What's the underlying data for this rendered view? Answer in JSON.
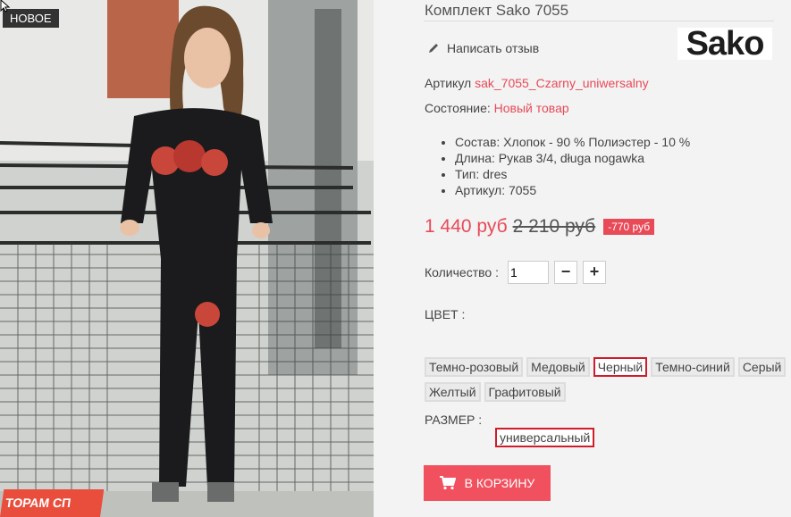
{
  "photo": {
    "badge": "НОВОЕ",
    "promo": "ТОРАМ СП"
  },
  "product": {
    "title": "Комплект Sako 7055",
    "review_label": "Написать отзыв",
    "brand_logo": "Sako",
    "sku_label": "Артикул",
    "sku_value": "sak_7055_Czarny_uniwersalny",
    "condition_label": "Состояние:",
    "condition_value": "Новый товар",
    "specs": [
      "Состав: Хлопок - 90 % Полиэстер - 10 %",
      "Длина: Рукав 3/4, długa nogawka",
      "Тип: dres",
      "Артикул: 7055"
    ],
    "price_new": "1 440 руб",
    "price_old": "2 210 руб",
    "price_save": "-770 руб"
  },
  "quantity": {
    "label": "Количество :",
    "value": "1",
    "minus": "−",
    "plus": "+"
  },
  "colors": {
    "label": "ЦВЕТ :",
    "row1": [
      "Темно-розовый",
      "Медовый",
      "Черный",
      "Темно-синий",
      "Серый"
    ],
    "row2": [
      "Желтый",
      "Графитовый"
    ],
    "selected": "Черный"
  },
  "sizes": {
    "label": "РАЗМЕР :",
    "options": [
      "универсальный"
    ],
    "selected": "универсальный"
  },
  "cart": {
    "label": "В КОРЗИНУ"
  },
  "theme": {
    "accent": "#e84a58",
    "button": "#f1515f",
    "selected_border": "#d01c2a"
  }
}
